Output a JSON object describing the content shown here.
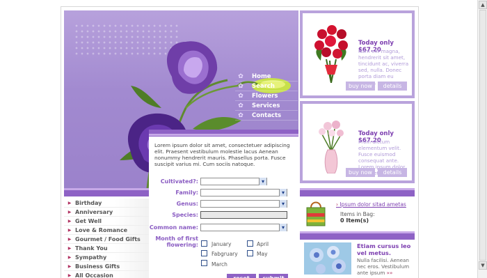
{
  "nav": {
    "items": [
      {
        "label": "Home"
      },
      {
        "label": "Search"
      },
      {
        "label": "Flowers"
      },
      {
        "label": "Services"
      },
      {
        "label": "Contacts"
      }
    ]
  },
  "products": [
    {
      "title": "Today only $67.20",
      "desc": "Nam elit magna, hendrerit sit amet, tincidunt ac, viverra sed, nulla. Donec porta diam eu massa.",
      "buy_label": "buy now",
      "details_label": "details"
    },
    {
      "title": "Today only $67.20",
      "desc": "Proin dictum elementum velit. Fusce euismod consequat ante. Lorem ipsum dolor sit amet.",
      "buy_label": "buy now",
      "details_label": "details"
    }
  ],
  "form": {
    "intro": "Lorem ipsum dolor sit amet, consectetuer adipiscing elit. Praesent vestibulum molestie lacus Aenean nonummy hendrerit mauris. Phasellus porta. Fusce suscipit varius mi. Cum sociis natoque.",
    "labels": {
      "cultivated": "Cultivated?:",
      "family": "Family:",
      "genus": "Genus:",
      "species": "Species:",
      "common_name": "Common name:",
      "month_line1": "Month of first",
      "month_line2": "flowering:"
    },
    "months": [
      "January",
      "April",
      "Fabgruary",
      "May",
      "March"
    ],
    "reset_label": "reset",
    "submit_label": "submit"
  },
  "sidebar": {
    "items": [
      {
        "label": "Birthday"
      },
      {
        "label": "Anniversary"
      },
      {
        "label": "Get Well"
      },
      {
        "label": "Love & Romance"
      },
      {
        "label": "Gourmet / Food Gifts"
      },
      {
        "label": "Thank You"
      },
      {
        "label": "Sympathy"
      },
      {
        "label": "Business Gifts"
      },
      {
        "label": "All Occasion"
      }
    ]
  },
  "cart": {
    "link": "Ipsum dolor sitad ametas",
    "items_label": "Items in Bag:",
    "count": "0 Item(s)"
  },
  "promo": {
    "title": "Etiam cursus leo vel metus.",
    "desc": "Nulla facilisi. Aenean nec eros. Vestibulum ante ipsum",
    "more": "»»"
  },
  "colors": {
    "accent": "#8e62c5",
    "light_accent": "#c7a9e8",
    "hero_bg": "#a28ad0"
  }
}
